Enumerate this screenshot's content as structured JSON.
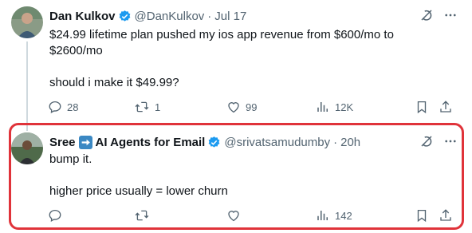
{
  "tweets": [
    {
      "name": "Dan Kulkov",
      "handle": "@DanKulkov",
      "time": "Jul 17",
      "text": "$24.99 lifetime plan pushed my ios app revenue from $600/mo to\n$2600/mo\n\nshould i make it $49.99?",
      "replies": "28",
      "retweets": "1",
      "likes": "99",
      "views": "12K"
    },
    {
      "name_part1": "Sree",
      "name_part2": "AI Agents for Email",
      "handle": "@srivatsamudumby",
      "time": "20h",
      "text": "bump it.\n\nhigher price usually = lower churn",
      "replies": "",
      "retweets": "",
      "likes": "",
      "views": "142"
    }
  ],
  "separator": "·",
  "colors": {
    "accent": "#1d9bf0",
    "muted": "#536471",
    "highlight": "#e0333a"
  },
  "icons": [
    "grok-icon",
    "more-icon",
    "reply-icon",
    "retweet-icon",
    "like-icon",
    "views-icon",
    "bookmark-icon",
    "share-icon",
    "verified-icon",
    "arrow-right-emoji"
  ]
}
